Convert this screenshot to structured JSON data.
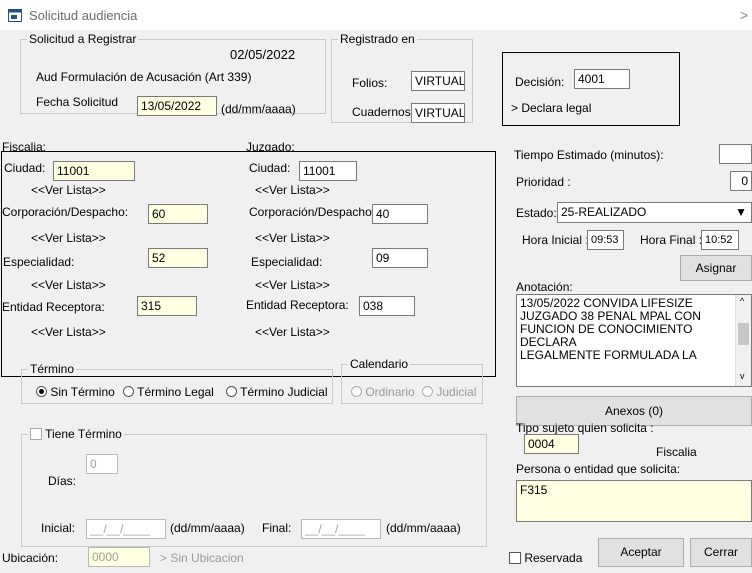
{
  "window": {
    "title": "Solicitud audiencia",
    "close_glyph": ">"
  },
  "solicitud": {
    "legend": "Solicitud a Registrar",
    "date": "02/05/2022",
    "tipo": "Aud Formulación de Acusación (Art 339)",
    "fecha_label": "Fecha Solicitud",
    "fecha_value": "13/05/2022",
    "fecha_format": "(dd/mm/aaaa)"
  },
  "registrado": {
    "legend": "Registrado en",
    "folios_label": "Folios:",
    "folios_value": "VIRTUAL",
    "cuadernos_label": "Cuadernos:",
    "cuadernos_value": "VIRTUAL"
  },
  "decision": {
    "label": "Decisión:",
    "value": "4001",
    "desc": "> Declara legal"
  },
  "fiscalia": {
    "header": "Fiscalia:",
    "ciudad_label": "Ciudad:",
    "ciudad_value": "11001",
    "ver1": "<<Ver Lista>>",
    "corp_label": "Corporación/Despacho:",
    "corp_value": "60",
    "ver2": "<<Ver Lista>>",
    "esp_label": "Especialidad:",
    "esp_value": "52",
    "ver3": "<<Ver Lista>>",
    "ent_label": "Entidad Receptora:",
    "ent_value": "315",
    "ver4": "<<Ver Lista>>"
  },
  "juzgado": {
    "header": "Juzgado:",
    "ciudad_label": "Ciudad:",
    "ciudad_value": "11001",
    "ver1": "<<Ver Lista>>",
    "corp_label": "Corporación/Despacho:",
    "corp_value": "40",
    "ver2": "<<Ver Lista>>",
    "esp_label": "Especialidad:",
    "esp_value": "09",
    "ver3": "<<Ver Lista>>",
    "ent_label": "Entidad Receptora:",
    "ent_value": "038",
    "ver4": "<<Ver Lista>>"
  },
  "right": {
    "tiempo_label": "Tiempo Estimado (minutos):",
    "tiempo_value": "",
    "prioridad_label": "Prioridad :",
    "prioridad_value": "0",
    "estado_label": "Estado:",
    "estado_value": "25-REALIZADO",
    "hora_inicial_label": "Hora Inicial :",
    "hora_inicial_value": "09:53",
    "hora_final_label": "Hora Final :",
    "hora_final_value": "10:52",
    "asignar_label": "Asignar",
    "anotacion_label": "Anotación:",
    "anotacion_lines": [
      "13/05/2022 CONVIDA LIFESIZE",
      "JUZGADO 38 PENAL MPAL CON",
      "FUNCION DE CONOCIMIENTO DECLARA",
      "LEGALMENTE FORMULADA LA"
    ],
    "anexos_label": "Anexos (0)",
    "tipo_sujeto_label": "Tipo sujeto quien solicita :",
    "tipo_sujeto_value": "0004",
    "tipo_sujeto_desc": "Fiscalia",
    "persona_label": "Persona o entidad que solicita:",
    "persona_value": "F315"
  },
  "termino": {
    "legend": "Término",
    "opt1": "Sin Término",
    "opt2": "Término Legal",
    "opt3": "Término Judicial"
  },
  "calendario": {
    "legend": "Calendario",
    "opt1": "Ordinario",
    "opt2": "Judicial"
  },
  "tiene": {
    "legend": "Tiene Término",
    "dias_label": "Días:",
    "dias_value": "0",
    "inicial_label": "Inicial:",
    "inicial_value": "__/__/____",
    "format1": "(dd/mm/aaaa)",
    "final_label": "Final:",
    "final_value": "__/__/____",
    "format2": "(dd/mm/aaaa)"
  },
  "footer": {
    "ubicacion_label": "Ubicación:",
    "ubicacion_value": "0000",
    "ubicacion_desc": "> Sin Ubicacion",
    "reservada_label": "Reservada",
    "aceptar_label": "Aceptar",
    "cerrar_label": "Cerrar"
  }
}
